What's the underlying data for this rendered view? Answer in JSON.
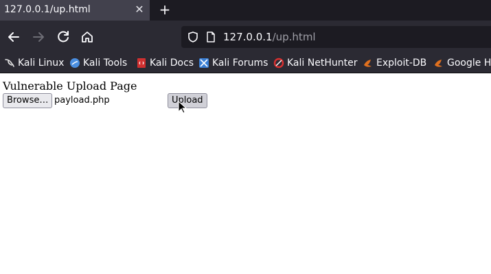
{
  "browser": {
    "tab_title": "127.0.0.1/up.html",
    "tab_close_glyph": "✕",
    "new_tab_glyph": "+",
    "url_host": "127.0.0.1",
    "url_path": "/up.html"
  },
  "bookmarks": [
    {
      "label": "Kali Linux",
      "icon": "kali-dragon-icon",
      "color": "#e8e8e8"
    },
    {
      "label": "Kali Tools",
      "icon": "kali-tools-icon",
      "color": "#4a8ee0"
    },
    {
      "label": "Kali Docs",
      "icon": "kali-docs-icon",
      "color": "#d03030"
    },
    {
      "label": "Kali Forums",
      "icon": "kali-forums-icon",
      "color": "#3a7fd5"
    },
    {
      "label": "Kali NetHunter",
      "icon": "kali-nethunter-icon",
      "color": "#d83030"
    },
    {
      "label": "Exploit-DB",
      "icon": "exploit-db-icon",
      "color": "#e0701e"
    },
    {
      "label": "Google Ha",
      "icon": "google-hacking-icon",
      "color": "#e0701e"
    }
  ],
  "page": {
    "heading": "Vulnerable Upload Page",
    "browse_label": "Browse…",
    "file_name": "payload.php",
    "upload_label": "Upload"
  },
  "colors": {
    "tab_bar": "#1c1b22",
    "toolbar": "#2b2a33",
    "active_tab": "#42414d"
  }
}
